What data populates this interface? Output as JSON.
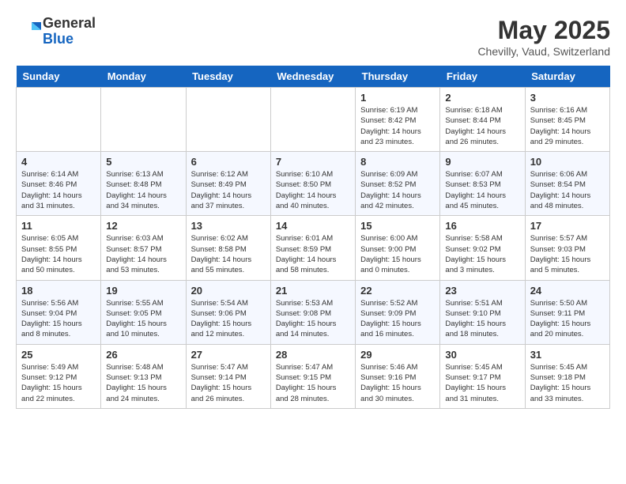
{
  "header": {
    "logo_general": "General",
    "logo_blue": "Blue",
    "month": "May 2025",
    "location": "Chevilly, Vaud, Switzerland"
  },
  "weekdays": [
    "Sunday",
    "Monday",
    "Tuesday",
    "Wednesday",
    "Thursday",
    "Friday",
    "Saturday"
  ],
  "weeks": [
    [
      {
        "day": "",
        "info": ""
      },
      {
        "day": "",
        "info": ""
      },
      {
        "day": "",
        "info": ""
      },
      {
        "day": "",
        "info": ""
      },
      {
        "day": "1",
        "info": "Sunrise: 6:19 AM\nSunset: 8:42 PM\nDaylight: 14 hours\nand 23 minutes."
      },
      {
        "day": "2",
        "info": "Sunrise: 6:18 AM\nSunset: 8:44 PM\nDaylight: 14 hours\nand 26 minutes."
      },
      {
        "day": "3",
        "info": "Sunrise: 6:16 AM\nSunset: 8:45 PM\nDaylight: 14 hours\nand 29 minutes."
      }
    ],
    [
      {
        "day": "4",
        "info": "Sunrise: 6:14 AM\nSunset: 8:46 PM\nDaylight: 14 hours\nand 31 minutes."
      },
      {
        "day": "5",
        "info": "Sunrise: 6:13 AM\nSunset: 8:48 PM\nDaylight: 14 hours\nand 34 minutes."
      },
      {
        "day": "6",
        "info": "Sunrise: 6:12 AM\nSunset: 8:49 PM\nDaylight: 14 hours\nand 37 minutes."
      },
      {
        "day": "7",
        "info": "Sunrise: 6:10 AM\nSunset: 8:50 PM\nDaylight: 14 hours\nand 40 minutes."
      },
      {
        "day": "8",
        "info": "Sunrise: 6:09 AM\nSunset: 8:52 PM\nDaylight: 14 hours\nand 42 minutes."
      },
      {
        "day": "9",
        "info": "Sunrise: 6:07 AM\nSunset: 8:53 PM\nDaylight: 14 hours\nand 45 minutes."
      },
      {
        "day": "10",
        "info": "Sunrise: 6:06 AM\nSunset: 8:54 PM\nDaylight: 14 hours\nand 48 minutes."
      }
    ],
    [
      {
        "day": "11",
        "info": "Sunrise: 6:05 AM\nSunset: 8:55 PM\nDaylight: 14 hours\nand 50 minutes."
      },
      {
        "day": "12",
        "info": "Sunrise: 6:03 AM\nSunset: 8:57 PM\nDaylight: 14 hours\nand 53 minutes."
      },
      {
        "day": "13",
        "info": "Sunrise: 6:02 AM\nSunset: 8:58 PM\nDaylight: 14 hours\nand 55 minutes."
      },
      {
        "day": "14",
        "info": "Sunrise: 6:01 AM\nSunset: 8:59 PM\nDaylight: 14 hours\nand 58 minutes."
      },
      {
        "day": "15",
        "info": "Sunrise: 6:00 AM\nSunset: 9:00 PM\nDaylight: 15 hours\nand 0 minutes."
      },
      {
        "day": "16",
        "info": "Sunrise: 5:58 AM\nSunset: 9:02 PM\nDaylight: 15 hours\nand 3 minutes."
      },
      {
        "day": "17",
        "info": "Sunrise: 5:57 AM\nSunset: 9:03 PM\nDaylight: 15 hours\nand 5 minutes."
      }
    ],
    [
      {
        "day": "18",
        "info": "Sunrise: 5:56 AM\nSunset: 9:04 PM\nDaylight: 15 hours\nand 8 minutes."
      },
      {
        "day": "19",
        "info": "Sunrise: 5:55 AM\nSunset: 9:05 PM\nDaylight: 15 hours\nand 10 minutes."
      },
      {
        "day": "20",
        "info": "Sunrise: 5:54 AM\nSunset: 9:06 PM\nDaylight: 15 hours\nand 12 minutes."
      },
      {
        "day": "21",
        "info": "Sunrise: 5:53 AM\nSunset: 9:08 PM\nDaylight: 15 hours\nand 14 minutes."
      },
      {
        "day": "22",
        "info": "Sunrise: 5:52 AM\nSunset: 9:09 PM\nDaylight: 15 hours\nand 16 minutes."
      },
      {
        "day": "23",
        "info": "Sunrise: 5:51 AM\nSunset: 9:10 PM\nDaylight: 15 hours\nand 18 minutes."
      },
      {
        "day": "24",
        "info": "Sunrise: 5:50 AM\nSunset: 9:11 PM\nDaylight: 15 hours\nand 20 minutes."
      }
    ],
    [
      {
        "day": "25",
        "info": "Sunrise: 5:49 AM\nSunset: 9:12 PM\nDaylight: 15 hours\nand 22 minutes."
      },
      {
        "day": "26",
        "info": "Sunrise: 5:48 AM\nSunset: 9:13 PM\nDaylight: 15 hours\nand 24 minutes."
      },
      {
        "day": "27",
        "info": "Sunrise: 5:47 AM\nSunset: 9:14 PM\nDaylight: 15 hours\nand 26 minutes."
      },
      {
        "day": "28",
        "info": "Sunrise: 5:47 AM\nSunset: 9:15 PM\nDaylight: 15 hours\nand 28 minutes."
      },
      {
        "day": "29",
        "info": "Sunrise: 5:46 AM\nSunset: 9:16 PM\nDaylight: 15 hours\nand 30 minutes."
      },
      {
        "day": "30",
        "info": "Sunrise: 5:45 AM\nSunset: 9:17 PM\nDaylight: 15 hours\nand 31 minutes."
      },
      {
        "day": "31",
        "info": "Sunrise: 5:45 AM\nSunset: 9:18 PM\nDaylight: 15 hours\nand 33 minutes."
      }
    ]
  ]
}
